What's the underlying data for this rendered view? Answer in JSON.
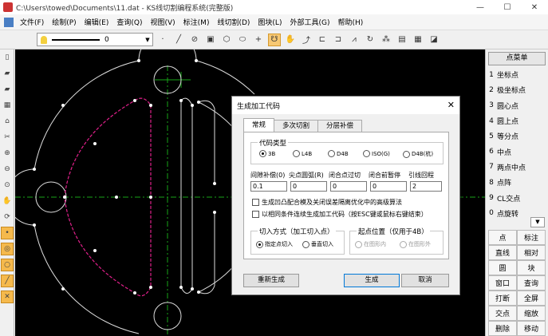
{
  "window": {
    "title": "C:\\Users\\towed\\Documents\\11.dat - KS线切割编程系统(完整版)",
    "controls": [
      "—",
      "☐",
      "✕"
    ]
  },
  "menu": [
    "文件(F)",
    "绘制(P)",
    "编辑(E)",
    "查询(Q)",
    "视图(V)",
    "标注(M)",
    "线切割(D)",
    "图块(L)",
    "外部工具(G)",
    "帮助(H)"
  ],
  "toolbar": {
    "layer_value": "0"
  },
  "right_panel": {
    "header": "点菜单",
    "items": [
      {
        "num": "1",
        "label": "坐标点"
      },
      {
        "num": "2",
        "label": "极坐标点"
      },
      {
        "num": "3",
        "label": "圆心点"
      },
      {
        "num": "4",
        "label": "圆上点"
      },
      {
        "num": "5",
        "label": "等分点"
      },
      {
        "num": "6",
        "label": "中点"
      },
      {
        "num": "7",
        "label": "两点中点"
      },
      {
        "num": "8",
        "label": "点阵"
      },
      {
        "num": "9",
        "label": "CL交点"
      },
      {
        "num": "0",
        "label": "点旋转"
      }
    ],
    "grid": [
      "点",
      "标注",
      "直线",
      "相对",
      "圆",
      "块",
      "窗口",
      "查询",
      "打断",
      "全屏",
      "交点",
      "缩放",
      "删除",
      "移动"
    ]
  },
  "dialog": {
    "title": "生成加工代码",
    "close": "✕",
    "tabs": [
      "常规",
      "多次切割",
      "分层补偿"
    ],
    "code_type": {
      "title": "代码类型",
      "options": [
        "3B",
        "L4B",
        "D4B",
        "ISO(G)",
        "D4B(杭)"
      ],
      "selected": 0
    },
    "fields": [
      {
        "label": "间隙补偿(0)",
        "value": "0.1"
      },
      {
        "label": "尖点圆弧(R)",
        "value": "0"
      },
      {
        "label": "闭合点过切",
        "value": "0"
      },
      {
        "label": "闭合前暂停",
        "value": "0"
      },
      {
        "label": "引线回程",
        "value": "2"
      }
    ],
    "checks": [
      "生成凹凸配合模及关闭误差隔离优化中的高级算法",
      "以相同条件连续生成加工代码（按ESC键或鼠标右键结束）"
    ],
    "cut_in": {
      "title": "切入方式（加工切入点）",
      "options": [
        "指定点切入",
        "垂直切入"
      ],
      "selected": 0
    },
    "start_pos": {
      "title": "起点位置（仅用于4B）",
      "options": [
        "在图形内",
        "在图形外"
      ]
    },
    "buttons": {
      "regen": "重新生成",
      "generate": "生成",
      "cancel": "取消"
    }
  }
}
